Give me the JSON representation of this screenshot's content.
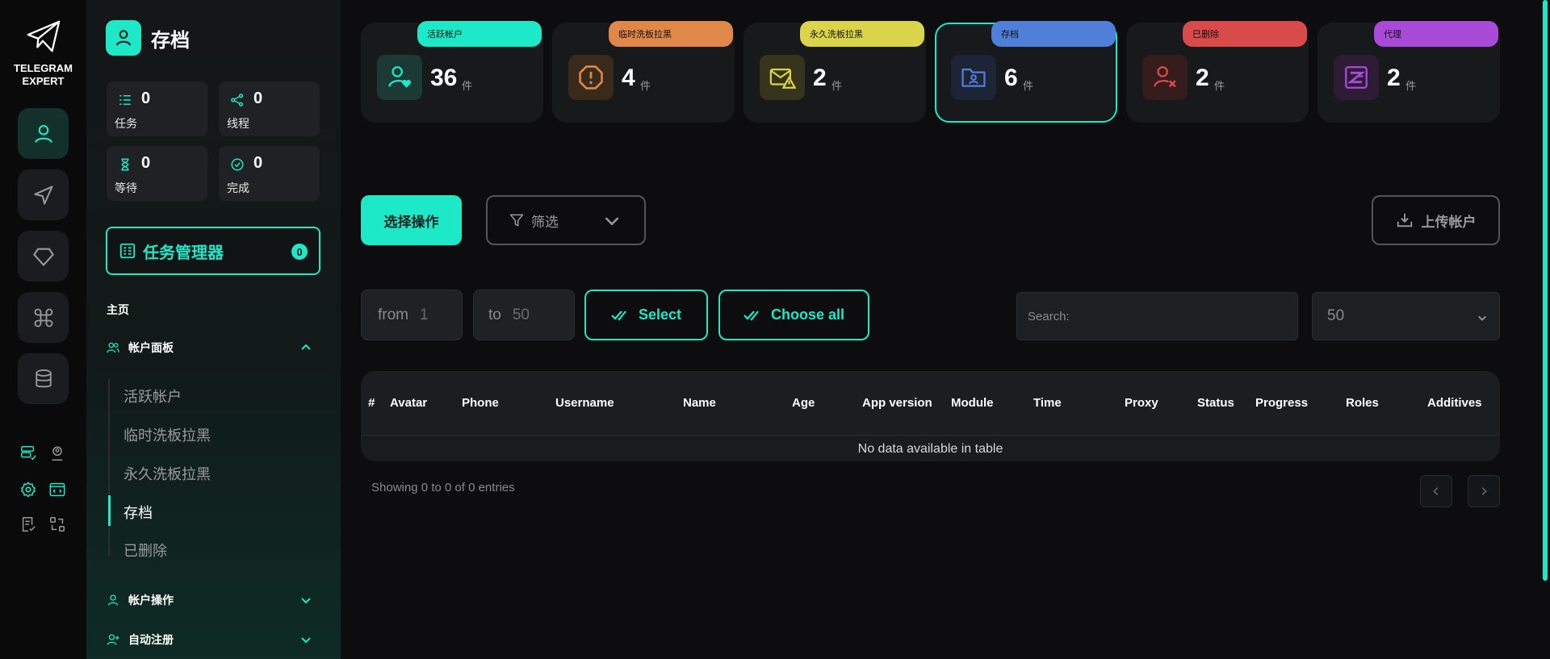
{
  "app": {
    "logo_line1": "TELEGRAM",
    "logo_line2": "EXPERT",
    "accent": "#1de9c9"
  },
  "rail": {
    "buttons": [
      "user-icon",
      "send-icon",
      "diamond-icon",
      "command-icon",
      "database-icon"
    ],
    "mini": [
      "server-check-icon",
      "user-pin-icon",
      "settings-icon",
      "code-window-icon",
      "doc-check-icon",
      "transfer-icon"
    ]
  },
  "sidebar": {
    "title": "存档",
    "stats": [
      {
        "label": "任务",
        "value": "0",
        "icon": "list-icon"
      },
      {
        "label": "线程",
        "value": "0",
        "icon": "share-icon"
      },
      {
        "label": "等待",
        "value": "0",
        "icon": "hourglass-icon"
      },
      {
        "label": "完成",
        "value": "0",
        "icon": "check-circle-icon"
      }
    ],
    "task_manager": {
      "label": "任务管理器",
      "count": "0"
    },
    "main_label": "主页",
    "groups": [
      {
        "label": "帐户面板",
        "expanded": true
      },
      {
        "label": "帐户操作",
        "expanded": false
      },
      {
        "label": "自动注册",
        "expanded": false
      }
    ],
    "sub_items": [
      "活跃帐户",
      "临时洗板拉黑",
      "永久洗板拉黑",
      "存档",
      "已删除"
    ],
    "active_sub": "存档"
  },
  "cards": [
    {
      "tag": "活跃帐户",
      "value": "36",
      "unit": "件",
      "color": "#1de9c9",
      "icon": "user-heart-icon"
    },
    {
      "tag": "临时洗板拉黑",
      "value": "4",
      "unit": "件",
      "color": "#e0884a",
      "icon": "alert-octagon-icon"
    },
    {
      "tag": "永久洗板拉黑",
      "value": "2",
      "unit": "件",
      "color": "#d9d44a",
      "icon": "mail-warning-icon"
    },
    {
      "tag": "存档",
      "value": "6",
      "unit": "件",
      "color": "#4f7fd9",
      "icon": "folder-user-icon",
      "active": true
    },
    {
      "tag": "已删除",
      "value": "2",
      "unit": "件",
      "color": "#d94a4a",
      "icon": "user-x-icon"
    },
    {
      "tag": "代理",
      "value": "2",
      "unit": "件",
      "color": "#a94ad9",
      "icon": "proxy-icon"
    }
  ],
  "toolbar": {
    "select_action": "选择操作",
    "filter": "筛选",
    "upload": "上传帐户",
    "from_label": "from",
    "from_value": "1",
    "to_label": "to",
    "to_value": "50",
    "select": "Select",
    "choose_all": "Choose all",
    "search_placeholder": "Search:",
    "per_page": "50"
  },
  "table": {
    "columns": [
      "#",
      "Avatar",
      "Phone",
      "Username",
      "Name",
      "Age",
      "App version",
      "Module",
      "Time",
      "Proxy",
      "Status",
      "Progress",
      "Roles",
      "Additives"
    ],
    "empty_text": "No data available in table",
    "info": "Showing 0 to 0 of 0 entries"
  }
}
